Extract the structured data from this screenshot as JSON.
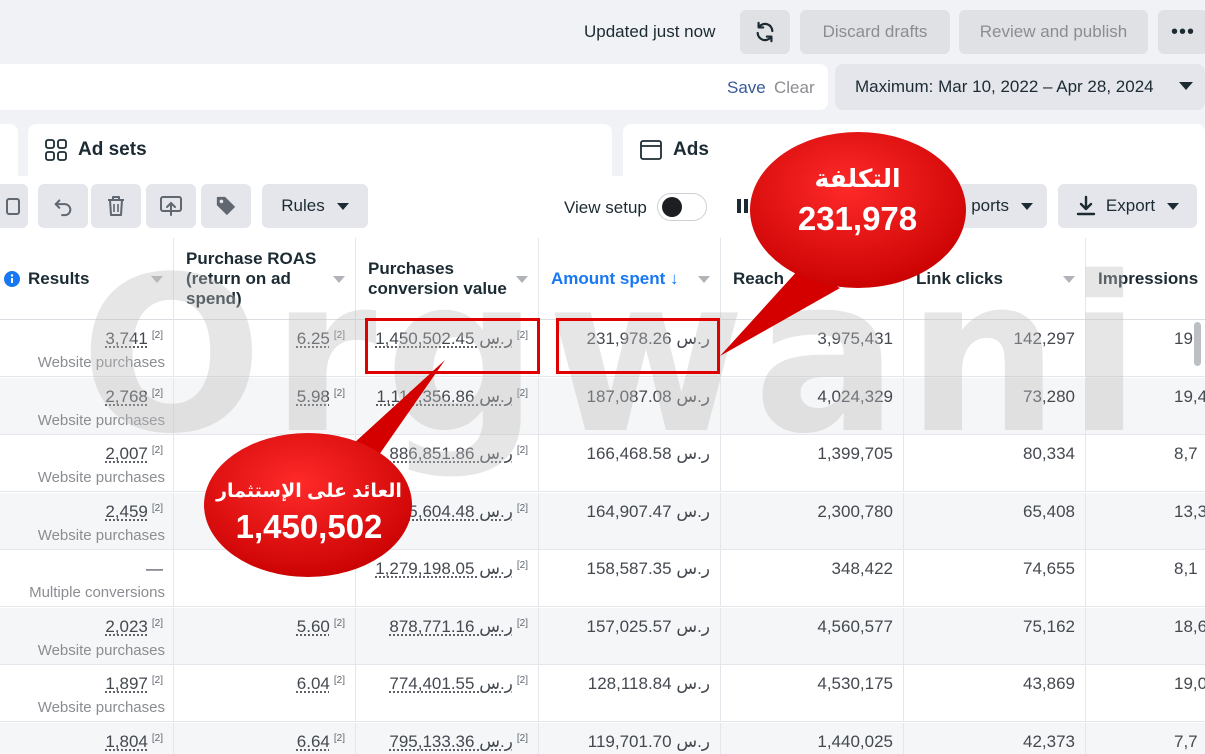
{
  "topbar": {
    "updated": "Updated just now",
    "discard": "Discard drafts",
    "review": "Review and publish",
    "more": "•••"
  },
  "search": {
    "save": "Save",
    "clear": "Clear"
  },
  "date_range": "Maximum: Mar 10, 2022 – Apr 28, 2024",
  "tabs": {
    "adsets": "Ad sets",
    "ads": "Ads"
  },
  "toolbar": {
    "rules": "Rules",
    "view_setup": "View setup",
    "reports": "ports",
    "export": "Export"
  },
  "columns": {
    "results": "Results",
    "roas": "Purchase ROAS (return on ad spend)",
    "conv_value": "Purchases conversion value",
    "amount_spent": "Amount spent ↓",
    "reach": "Reach",
    "link_clicks": "Link clicks",
    "impressions": "Impressions"
  },
  "rows": [
    {
      "results": "3,741",
      "results_sub": "Website purchases",
      "roas": "6.25",
      "conv": "1,450,502.45 ر.س",
      "spent": "231,978.26 ر.س",
      "reach": "3,975,431",
      "clicks": "142,297",
      "impr": "19,"
    },
    {
      "results": "2,768",
      "results_sub": "Website purchases",
      "roas": "5.98",
      "conv": "1,119,356.86 ر.س",
      "spent": "187,087.08 ر.س",
      "reach": "4,024,329",
      "clicks": "73,280",
      "impr": "19,4"
    },
    {
      "results": "2,007",
      "results_sub": "Website purchases",
      "roas": "",
      "conv": "886,851.86 ر.س",
      "spent": "166,468.58 ر.س",
      "reach": "1,399,705",
      "clicks": "80,334",
      "impr": "8,7"
    },
    {
      "results": "2,459",
      "results_sub": "Website purchases",
      "roas": "",
      "conv": "5,604.48 ر.س",
      "spent": "164,907.47 ر.س",
      "reach": "2,300,780",
      "clicks": "65,408",
      "impr": "13,3"
    },
    {
      "results": "—",
      "results_sub": "Multiple conversions",
      "roas": "",
      "conv": "1,279,198.05 ر.س",
      "spent": "158,587.35 ر.س",
      "reach": "348,422",
      "clicks": "74,655",
      "impr": "8,1"
    },
    {
      "results": "2,023",
      "results_sub": "Website purchases",
      "roas": "5.60",
      "conv": "878,771.16 ر.س",
      "spent": "157,025.57 ر.س",
      "reach": "4,560,577",
      "clicks": "75,162",
      "impr": "18,6"
    },
    {
      "results": "1,897",
      "results_sub": "Website purchases",
      "roas": "6.04",
      "conv": "774,401.55 ر.س",
      "spent": "128,118.84 ر.س",
      "reach": "4,530,175",
      "clicks": "43,869",
      "impr": "19,0"
    },
    {
      "results": "1,804",
      "results_sub": "",
      "roas": "6.64",
      "conv": "795,133.36 ر.س",
      "spent": "119,701.70 ر.س",
      "reach": "1,440,025",
      "clicks": "42,373",
      "impr": "7,7"
    }
  ],
  "footnote_mark": "[2]",
  "watermark": "Orgwani",
  "callout_cost": {
    "label": "التكلفة",
    "value": "231,978"
  },
  "callout_roi": {
    "label": "العائد على الإستثمار",
    "value": "1,450,502"
  },
  "colors": {
    "accent": "#1877f2",
    "highlight": "#e00000"
  }
}
